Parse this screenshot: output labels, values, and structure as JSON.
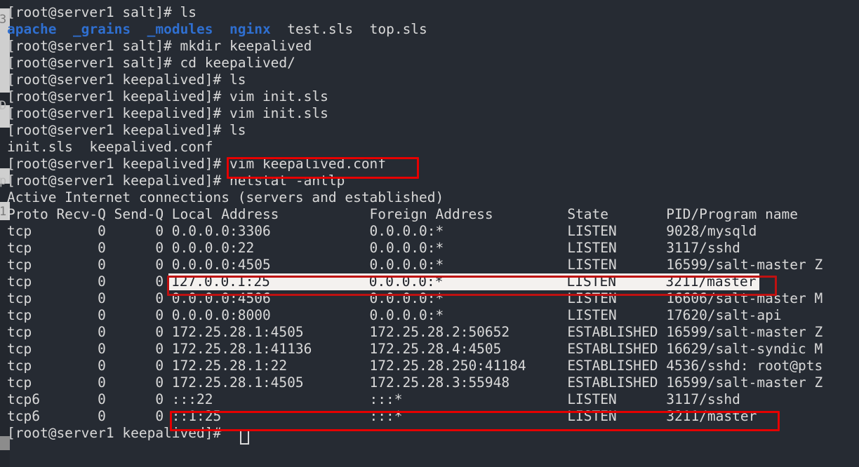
{
  "terminal": {
    "colors": {
      "background": "#262b33",
      "foreground": "#d9d9d9",
      "directory_blue": "#2f6fd0",
      "annotation_red": "#e60000",
      "highlight_background": "#f4f1ef",
      "highlight_foreground": "#1d2027"
    },
    "prompt_salt": "[root@server1 salt]# ",
    "prompt_keepalived": "[root@server1 keepalived]# ",
    "lines": [
      {
        "id": "line-01-ls",
        "type": "command",
        "text": "[root@server1 salt]# ls"
      },
      {
        "id": "line-02-ls-output",
        "type": "ls-output",
        "entries": [
          {
            "name": "apache",
            "kind": "dir"
          },
          {
            "name": "_grains",
            "kind": "dir"
          },
          {
            "name": "_modules",
            "kind": "dir"
          },
          {
            "name": "nginx",
            "kind": "dir"
          },
          {
            "name": "test.sls",
            "kind": "file"
          },
          {
            "name": "top.sls",
            "kind": "file"
          }
        ]
      },
      {
        "id": "line-03-mkdir",
        "type": "command",
        "text": "[root@server1 salt]# mkdir keepalived"
      },
      {
        "id": "line-04-cd",
        "type": "command",
        "text": "[root@server1 salt]# cd keepalived/"
      },
      {
        "id": "line-05-ls",
        "type": "command",
        "text": "[root@server1 keepalived]# ls"
      },
      {
        "id": "line-06-vim",
        "type": "command",
        "text": "[root@server1 keepalived]# vim init.sls"
      },
      {
        "id": "line-07-vim",
        "type": "command",
        "text": "[root@server1 keepalived]# vim init.sls"
      },
      {
        "id": "line-08-ls",
        "type": "command",
        "text": "[root@server1 keepalived]# ls"
      },
      {
        "id": "line-09-ls-out",
        "type": "output",
        "text": "init.sls  keepalived.conf"
      },
      {
        "id": "line-10-vim-conf",
        "type": "command",
        "text": "[root@server1 keepalived]# vim keepalived.conf"
      },
      {
        "id": "line-11-netstat",
        "type": "command",
        "text": "[root@server1 keepalived]# netstat -antlp"
      },
      {
        "id": "line-12-banner",
        "type": "output",
        "text": "Active Internet connections (servers and established)"
      }
    ],
    "final_prompt": "[root@server1 keepalived]# "
  },
  "netstat": {
    "title": "Active Internet connections (servers and established)",
    "command": "netstat -antlp",
    "headers": [
      "Proto",
      "Recv-Q",
      "Send-Q",
      "Local Address",
      "Foreign Address",
      "State",
      "PID/Program name"
    ],
    "header_line": "Proto Recv-Q Send-Q Local Address           Foreign Address         State       PID/Program name",
    "rows": [
      {
        "proto": "tcp",
        "recvq": "0",
        "sendq": "0",
        "local": "0.0.0.0:3306",
        "foreign": "0.0.0.0:*",
        "state": "LISTEN",
        "pid_program": "9028/mysqld",
        "highlight": false,
        "line": "tcp        0      0 0.0.0.0:3306            0.0.0.0:*               LISTEN      9028/mysqld"
      },
      {
        "proto": "tcp",
        "recvq": "0",
        "sendq": "0",
        "local": "0.0.0.0:22",
        "foreign": "0.0.0.0:*",
        "state": "LISTEN",
        "pid_program": "3117/sshd",
        "highlight": false,
        "line": "tcp        0      0 0.0.0.0:22              0.0.0.0:*               LISTEN      3117/sshd"
      },
      {
        "proto": "tcp",
        "recvq": "0",
        "sendq": "0",
        "local": "0.0.0.0:4505",
        "foreign": "0.0.0.0:*",
        "state": "LISTEN",
        "pid_program": "16599/salt-master Z",
        "highlight": false,
        "line": "tcp        0      0 0.0.0.0:4505            0.0.0.0:*               LISTEN      16599/salt-master Z"
      },
      {
        "proto": "tcp",
        "recvq": "0",
        "sendq": "0",
        "local": "127.0.0.1:25",
        "foreign": "0.0.0.0:*",
        "state": "LISTEN",
        "pid_program": "3211/master",
        "highlight": true,
        "line": "tcp        0      0 127.0.0.1:25            0.0.0.0:*               LISTEN      3211/master",
        "highlight_text": "127.0.0.1:25            0.0.0.0:*               LISTEN      3211/master"
      },
      {
        "proto": "tcp",
        "recvq": "0",
        "sendq": "0",
        "local": "0.0.0.0:4506",
        "foreign": "0.0.0.0:*",
        "state": "LISTEN",
        "pid_program": "16606/salt-master M",
        "highlight": false,
        "line": "tcp        0      0 0.0.0.0:4506            0.0.0.0:*               LISTEN      16606/salt-master M"
      },
      {
        "proto": "tcp",
        "recvq": "0",
        "sendq": "0",
        "local": "0.0.0.0:8000",
        "foreign": "0.0.0.0:*",
        "state": "LISTEN",
        "pid_program": "17620/salt-api",
        "highlight": false,
        "line": "tcp        0      0 0.0.0.0:8000            0.0.0.0:*               LISTEN      17620/salt-api"
      },
      {
        "proto": "tcp",
        "recvq": "0",
        "sendq": "0",
        "local": "172.25.28.1:4505",
        "foreign": "172.25.28.2:50652",
        "state": "ESTABLISHED",
        "pid_program": "16599/salt-master Z",
        "highlight": false,
        "line": "tcp        0      0 172.25.28.1:4505        172.25.28.2:50652       ESTABLISHED 16599/salt-master Z"
      },
      {
        "proto": "tcp",
        "recvq": "0",
        "sendq": "0",
        "local": "172.25.28.1:41136",
        "foreign": "172.25.28.4:4505",
        "state": "ESTABLISHED",
        "pid_program": "16629/salt-syndic M",
        "highlight": false,
        "line": "tcp        0      0 172.25.28.1:41136       172.25.28.4:4505        ESTABLISHED 16629/salt-syndic M"
      },
      {
        "proto": "tcp",
        "recvq": "0",
        "sendq": "0",
        "local": "172.25.28.1:22",
        "foreign": "172.25.28.250:41184",
        "state": "ESTABLISHED",
        "pid_program": "4536/sshd: root@pts",
        "highlight": false,
        "line": "tcp        0      0 172.25.28.1:22          172.25.28.250:41184     ESTABLISHED 4536/sshd: root@pts"
      },
      {
        "proto": "tcp",
        "recvq": "0",
        "sendq": "0",
        "local": "172.25.28.1:4505",
        "foreign": "172.25.28.3:55948",
        "state": "ESTABLISHED",
        "pid_program": "16599/salt-master Z",
        "highlight": false,
        "line": "tcp        0      0 172.25.28.1:4505        172.25.28.3:55948       ESTABLISHED 16599/salt-master Z"
      },
      {
        "proto": "tcp6",
        "recvq": "0",
        "sendq": "0",
        "local": ":::22",
        "foreign": ":::*",
        "state": "LISTEN",
        "pid_program": "3117/sshd",
        "highlight": false,
        "line": "tcp6       0      0 :::22                   :::*                    LISTEN      3117/sshd"
      },
      {
        "proto": "tcp6",
        "recvq": "0",
        "sendq": "0",
        "local": "::1:25",
        "foreign": ":::*",
        "state": "LISTEN",
        "pid_program": "3211/master",
        "highlight": false,
        "line": "tcp6       0      0 ::1:25                  :::*                    LISTEN      3211/master"
      }
    ]
  },
  "annotations": [
    {
      "id": "annotation-vim-keepalived-conf",
      "label": "vim keepalived.conf",
      "shape": "rectangle",
      "color": "#e60000"
    },
    {
      "id": "annotation-ipv4-smtp-row",
      "label": "tcp 127.0.0.1:25 LISTEN 3211/master",
      "shape": "rectangle",
      "color": "#bf1111"
    },
    {
      "id": "annotation-ipv6-smtp-row",
      "label": "tcp6 ::1:25 LISTEN 3211/master",
      "shape": "rectangle",
      "color": "#e60000"
    }
  ],
  "edge_artifacts": {
    "description": "partial underlying window visible at left screen edge",
    "glyphs": [
      "3",
      "D",
      "p",
      "1"
    ]
  }
}
